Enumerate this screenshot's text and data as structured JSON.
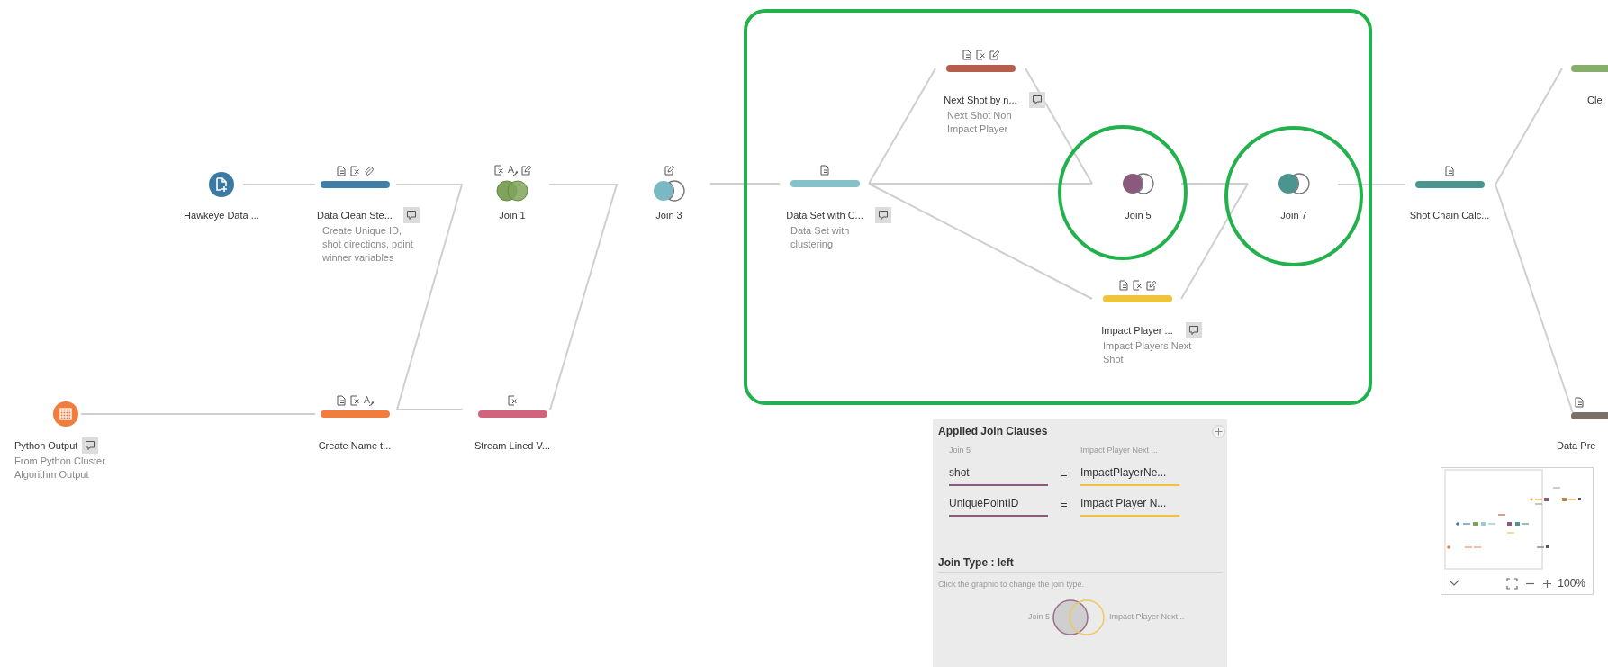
{
  "flow": {
    "nodes": [
      {
        "kind": "file",
        "label": "Hawkeye Data ...",
        "color": "#3b7aa3"
      },
      {
        "kind": "step",
        "label": "Data Clean Ste...",
        "color": "#3f7ea6",
        "description": "Create Unique ID, shot directions, point winner variables"
      },
      {
        "kind": "join",
        "label": "Join 1",
        "color": "#7fa35a"
      },
      {
        "kind": "join",
        "label": "Join 3",
        "color": "#7ab8c4"
      },
      {
        "kind": "step",
        "label": "Data Set with C...",
        "color": "#86c1ca",
        "description": "Data Set with clustering"
      },
      {
        "kind": "step",
        "label": "Next Shot by n...",
        "color": "#b65e4c",
        "description": "Next Shot Non Impact Player"
      },
      {
        "kind": "join",
        "label": "Join 5",
        "color": "#8a5a7e"
      },
      {
        "kind": "join",
        "label": "Join 7",
        "color": "#4a9590"
      },
      {
        "kind": "step",
        "label": "Impact Player ...",
        "color": "#efc43c",
        "description": "Impact Players Next Shot"
      },
      {
        "kind": "step",
        "label": "Shot Chain Calc...",
        "color": "#4a9590"
      },
      {
        "kind": "step",
        "label": "Cle",
        "color": "#86b06a"
      },
      {
        "kind": "table",
        "label": "Python Output",
        "color": "#f07c3e",
        "description": "From Python Cluster Algorithm Output"
      },
      {
        "kind": "step",
        "label": "Create Name t...",
        "color": "#f07c3e"
      },
      {
        "kind": "step",
        "label": "Stream Lined V...",
        "color": "#d0647c"
      },
      {
        "kind": "step",
        "label": "Data Pre",
        "color": "#7a7068"
      }
    ]
  },
  "join_panel": {
    "title": "Applied Join Clauses",
    "left_header": "Join 5",
    "right_header": "Impact Player Next ...",
    "clauses": [
      {
        "left": "shot",
        "operator": "=",
        "right": "ImpactPlayerNe..."
      },
      {
        "left": "UniquePointID",
        "operator": "=",
        "right": "Impact Player N..."
      }
    ],
    "join_type_title": "Join Type : left",
    "hint": "Click the graphic to change the join type.",
    "left_label": "Join 5",
    "right_label": "Impact Player Next..."
  },
  "minimap": {
    "zoom": "100%"
  }
}
